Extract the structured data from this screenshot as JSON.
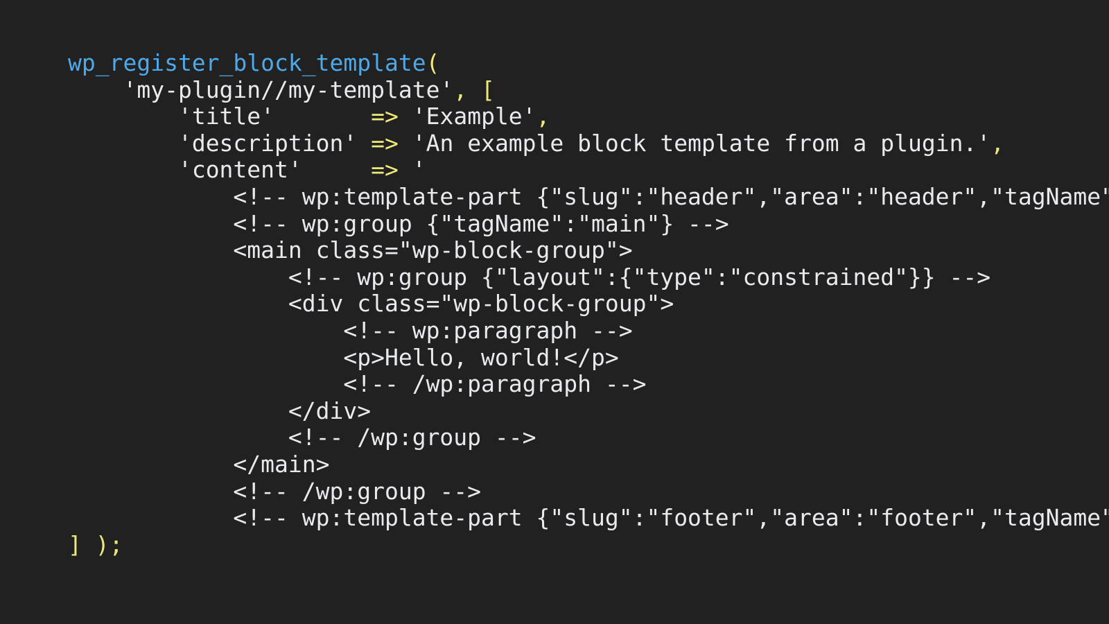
{
  "editor": {
    "background_color": "#212121",
    "language": "php",
    "font_size_px": 33
  },
  "palette": {
    "function": "#4fa8e8",
    "punctuation": "#ede97a",
    "operator": "#ede97a",
    "string": "#e8eaed",
    "markup": "#e8eaed"
  },
  "code": {
    "lines": [
      {
        "index": 1,
        "text": "wp_register_block_template(",
        "tokens": [
          {
            "t": "wp_register_block_template",
            "c": "fn"
          },
          {
            "t": "(",
            "c": "punct"
          }
        ]
      },
      {
        "index": 2,
        "text": "    'my-plugin//my-template', [",
        "tokens": [
          {
            "t": "    ",
            "c": "plain"
          },
          {
            "t": "'my-plugin//my-template'",
            "c": "str"
          },
          {
            "t": ",",
            "c": "punct"
          },
          {
            "t": " ",
            "c": "plain"
          },
          {
            "t": "[",
            "c": "punct"
          }
        ]
      },
      {
        "index": 3,
        "text": "        'title'       => 'Example',",
        "tokens": [
          {
            "t": "        ",
            "c": "plain"
          },
          {
            "t": "'title'",
            "c": "str"
          },
          {
            "t": "       ",
            "c": "plain"
          },
          {
            "t": "=>",
            "c": "op"
          },
          {
            "t": " ",
            "c": "plain"
          },
          {
            "t": "'Example'",
            "c": "str"
          },
          {
            "t": ",",
            "c": "punct"
          }
        ]
      },
      {
        "index": 4,
        "text": "        'description' => 'An example block template from a plugin.',",
        "tokens": [
          {
            "t": "        ",
            "c": "plain"
          },
          {
            "t": "'description'",
            "c": "str"
          },
          {
            "t": " ",
            "c": "plain"
          },
          {
            "t": "=>",
            "c": "op"
          },
          {
            "t": " ",
            "c": "plain"
          },
          {
            "t": "'An example block template from a plugin.'",
            "c": "str"
          },
          {
            "t": ",",
            "c": "punct"
          }
        ]
      },
      {
        "index": 5,
        "text": "        'content'     => '",
        "tokens": [
          {
            "t": "        ",
            "c": "plain"
          },
          {
            "t": "'content'",
            "c": "str"
          },
          {
            "t": "     ",
            "c": "plain"
          },
          {
            "t": "=>",
            "c": "op"
          },
          {
            "t": " ",
            "c": "plain"
          },
          {
            "t": "'",
            "c": "str"
          }
        ]
      },
      {
        "index": 6,
        "text": "            <!-- wp:template-part {\"slug\":\"header\",\"area\":\"header\",\"tagName\":\"header\"} /-->",
        "tokens": [
          {
            "t": "            ",
            "c": "plain"
          },
          {
            "t": "<!-- wp:template-part {\"slug\":\"header\",\"area\":\"header\",\"tagName\":\"header\"} /-->",
            "c": "markup"
          }
        ]
      },
      {
        "index": 7,
        "text": "            <!-- wp:group {\"tagName\":\"main\"} -->",
        "tokens": [
          {
            "t": "            ",
            "c": "plain"
          },
          {
            "t": "<!-- wp:group {\"tagName\":\"main\"} -->",
            "c": "markup"
          }
        ]
      },
      {
        "index": 8,
        "text": "            <main class=\"wp-block-group\">",
        "tokens": [
          {
            "t": "            ",
            "c": "plain"
          },
          {
            "t": "<main class=\"wp-block-group\">",
            "c": "markup"
          }
        ]
      },
      {
        "index": 9,
        "text": "                <!-- wp:group {\"layout\":{\"type\":\"constrained\"}} -->",
        "tokens": [
          {
            "t": "                ",
            "c": "plain"
          },
          {
            "t": "<!-- wp:group {\"layout\":{\"type\":\"constrained\"}} -->",
            "c": "markup"
          }
        ]
      },
      {
        "index": 10,
        "text": "                <div class=\"wp-block-group\">",
        "tokens": [
          {
            "t": "                ",
            "c": "plain"
          },
          {
            "t": "<div class=\"wp-block-group\">",
            "c": "markup"
          }
        ]
      },
      {
        "index": 11,
        "text": "                    <!-- wp:paragraph -->",
        "tokens": [
          {
            "t": "                    ",
            "c": "plain"
          },
          {
            "t": "<!-- wp:paragraph -->",
            "c": "markup"
          }
        ]
      },
      {
        "index": 12,
        "text": "                    <p>Hello, world!</p>",
        "tokens": [
          {
            "t": "                    ",
            "c": "plain"
          },
          {
            "t": "<p>Hello, world!</p>",
            "c": "markup"
          }
        ]
      },
      {
        "index": 13,
        "text": "                    <!-- /wp:paragraph -->",
        "tokens": [
          {
            "t": "                    ",
            "c": "plain"
          },
          {
            "t": "<!-- /wp:paragraph -->",
            "c": "markup"
          }
        ]
      },
      {
        "index": 14,
        "text": "                </div>",
        "tokens": [
          {
            "t": "                ",
            "c": "plain"
          },
          {
            "t": "</div>",
            "c": "markup"
          }
        ]
      },
      {
        "index": 15,
        "text": "                <!-- /wp:group -->",
        "tokens": [
          {
            "t": "                ",
            "c": "plain"
          },
          {
            "t": "<!-- /wp:group -->",
            "c": "markup"
          }
        ]
      },
      {
        "index": 16,
        "text": "            </main>",
        "tokens": [
          {
            "t": "            ",
            "c": "plain"
          },
          {
            "t": "</main>",
            "c": "markup"
          }
        ]
      },
      {
        "index": 17,
        "text": "            <!-- /wp:group -->",
        "tokens": [
          {
            "t": "            ",
            "c": "plain"
          },
          {
            "t": "<!-- /wp:group -->",
            "c": "markup"
          }
        ]
      },
      {
        "index": 18,
        "text": "            <!-- wp:template-part {\"slug\":\"footer\",\"area\":\"footer\",\"tagName\":\"footer\"} /-->",
        "tokens": [
          {
            "t": "            ",
            "c": "plain"
          },
          {
            "t": "<!-- wp:template-part {\"slug\":\"footer\",\"area\":\"footer\",\"tagName\":\"footer\"} /-->",
            "c": "markup"
          }
        ]
      },
      {
        "index": 19,
        "text": "] );",
        "tokens": [
          {
            "t": "]",
            "c": "punct"
          },
          {
            "t": " ",
            "c": "plain"
          },
          {
            "t": ")",
            "c": "punct"
          },
          {
            "t": ";",
            "c": "punct"
          }
        ]
      }
    ]
  }
}
